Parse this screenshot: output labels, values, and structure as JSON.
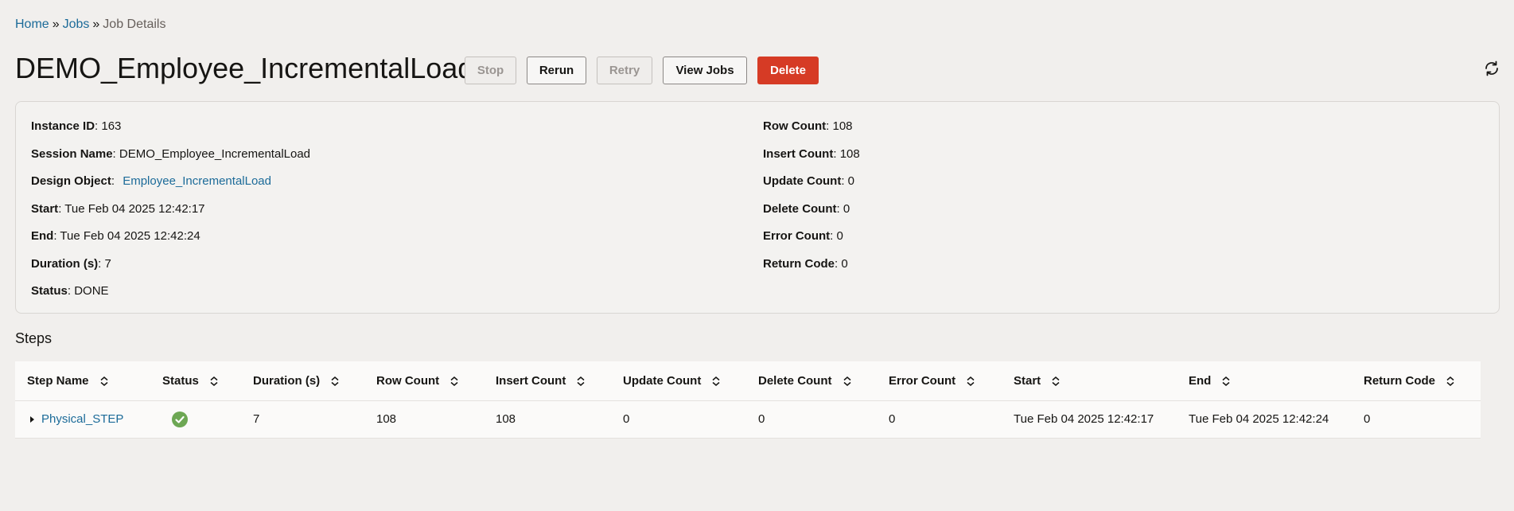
{
  "breadcrumb": {
    "home": "Home",
    "sep1": "»",
    "jobs": "Jobs",
    "sep2": "»",
    "current": "Job Details"
  },
  "page": {
    "title": "DEMO_Employee_IncrementalLoad"
  },
  "toolbar": {
    "stop_label": "Stop",
    "rerun_label": "Rerun",
    "retry_label": "Retry",
    "view_jobs_label": "View Jobs",
    "delete_label": "Delete",
    "refresh_icon": "refresh-icon"
  },
  "details": {
    "left": [
      {
        "label": "Instance ID",
        "value": "163"
      },
      {
        "label": "Session Name",
        "value": "DEMO_Employee_IncrementalLoad"
      },
      {
        "label": "Design Object",
        "value": "Employee_IncrementalLoad"
      },
      {
        "label": "Start",
        "value": "Tue Feb 04 2025 12:42:17"
      },
      {
        "label": "End",
        "value": "Tue Feb 04 2025 12:42:24"
      },
      {
        "label": "Duration (s)",
        "value": "7"
      },
      {
        "label": "Status",
        "value": "DONE"
      }
    ],
    "right": [
      {
        "label": "Row Count",
        "value": "108"
      },
      {
        "label": "Insert Count",
        "value": "108"
      },
      {
        "label": "Update Count",
        "value": "0"
      },
      {
        "label": "Delete Count",
        "value": "0"
      },
      {
        "label": "Error Count",
        "value": "0"
      },
      {
        "label": "Return Code",
        "value": "0"
      }
    ]
  },
  "steps": {
    "title": "Steps",
    "columns": [
      "Step Name",
      "Status",
      "Duration (s)",
      "Row Count",
      "Insert Count",
      "Update Count",
      "Delete Count",
      "Error Count",
      "Start",
      "End",
      "Return Code"
    ],
    "rows": [
      {
        "step_name": "Physical_STEP",
        "status_icon": "success-check-icon",
        "duration": "7",
        "row_count": "108",
        "insert_count": "108",
        "update_count": "0",
        "delete_count": "0",
        "error_count": "0",
        "start": "Tue Feb 04 2025 12:42:17",
        "end": "Tue Feb 04 2025 12:42:24",
        "return_code": "0"
      }
    ]
  },
  "colors": {
    "link": "#1c6b99",
    "delete_button": "#d63b25",
    "success": "#6da754"
  }
}
